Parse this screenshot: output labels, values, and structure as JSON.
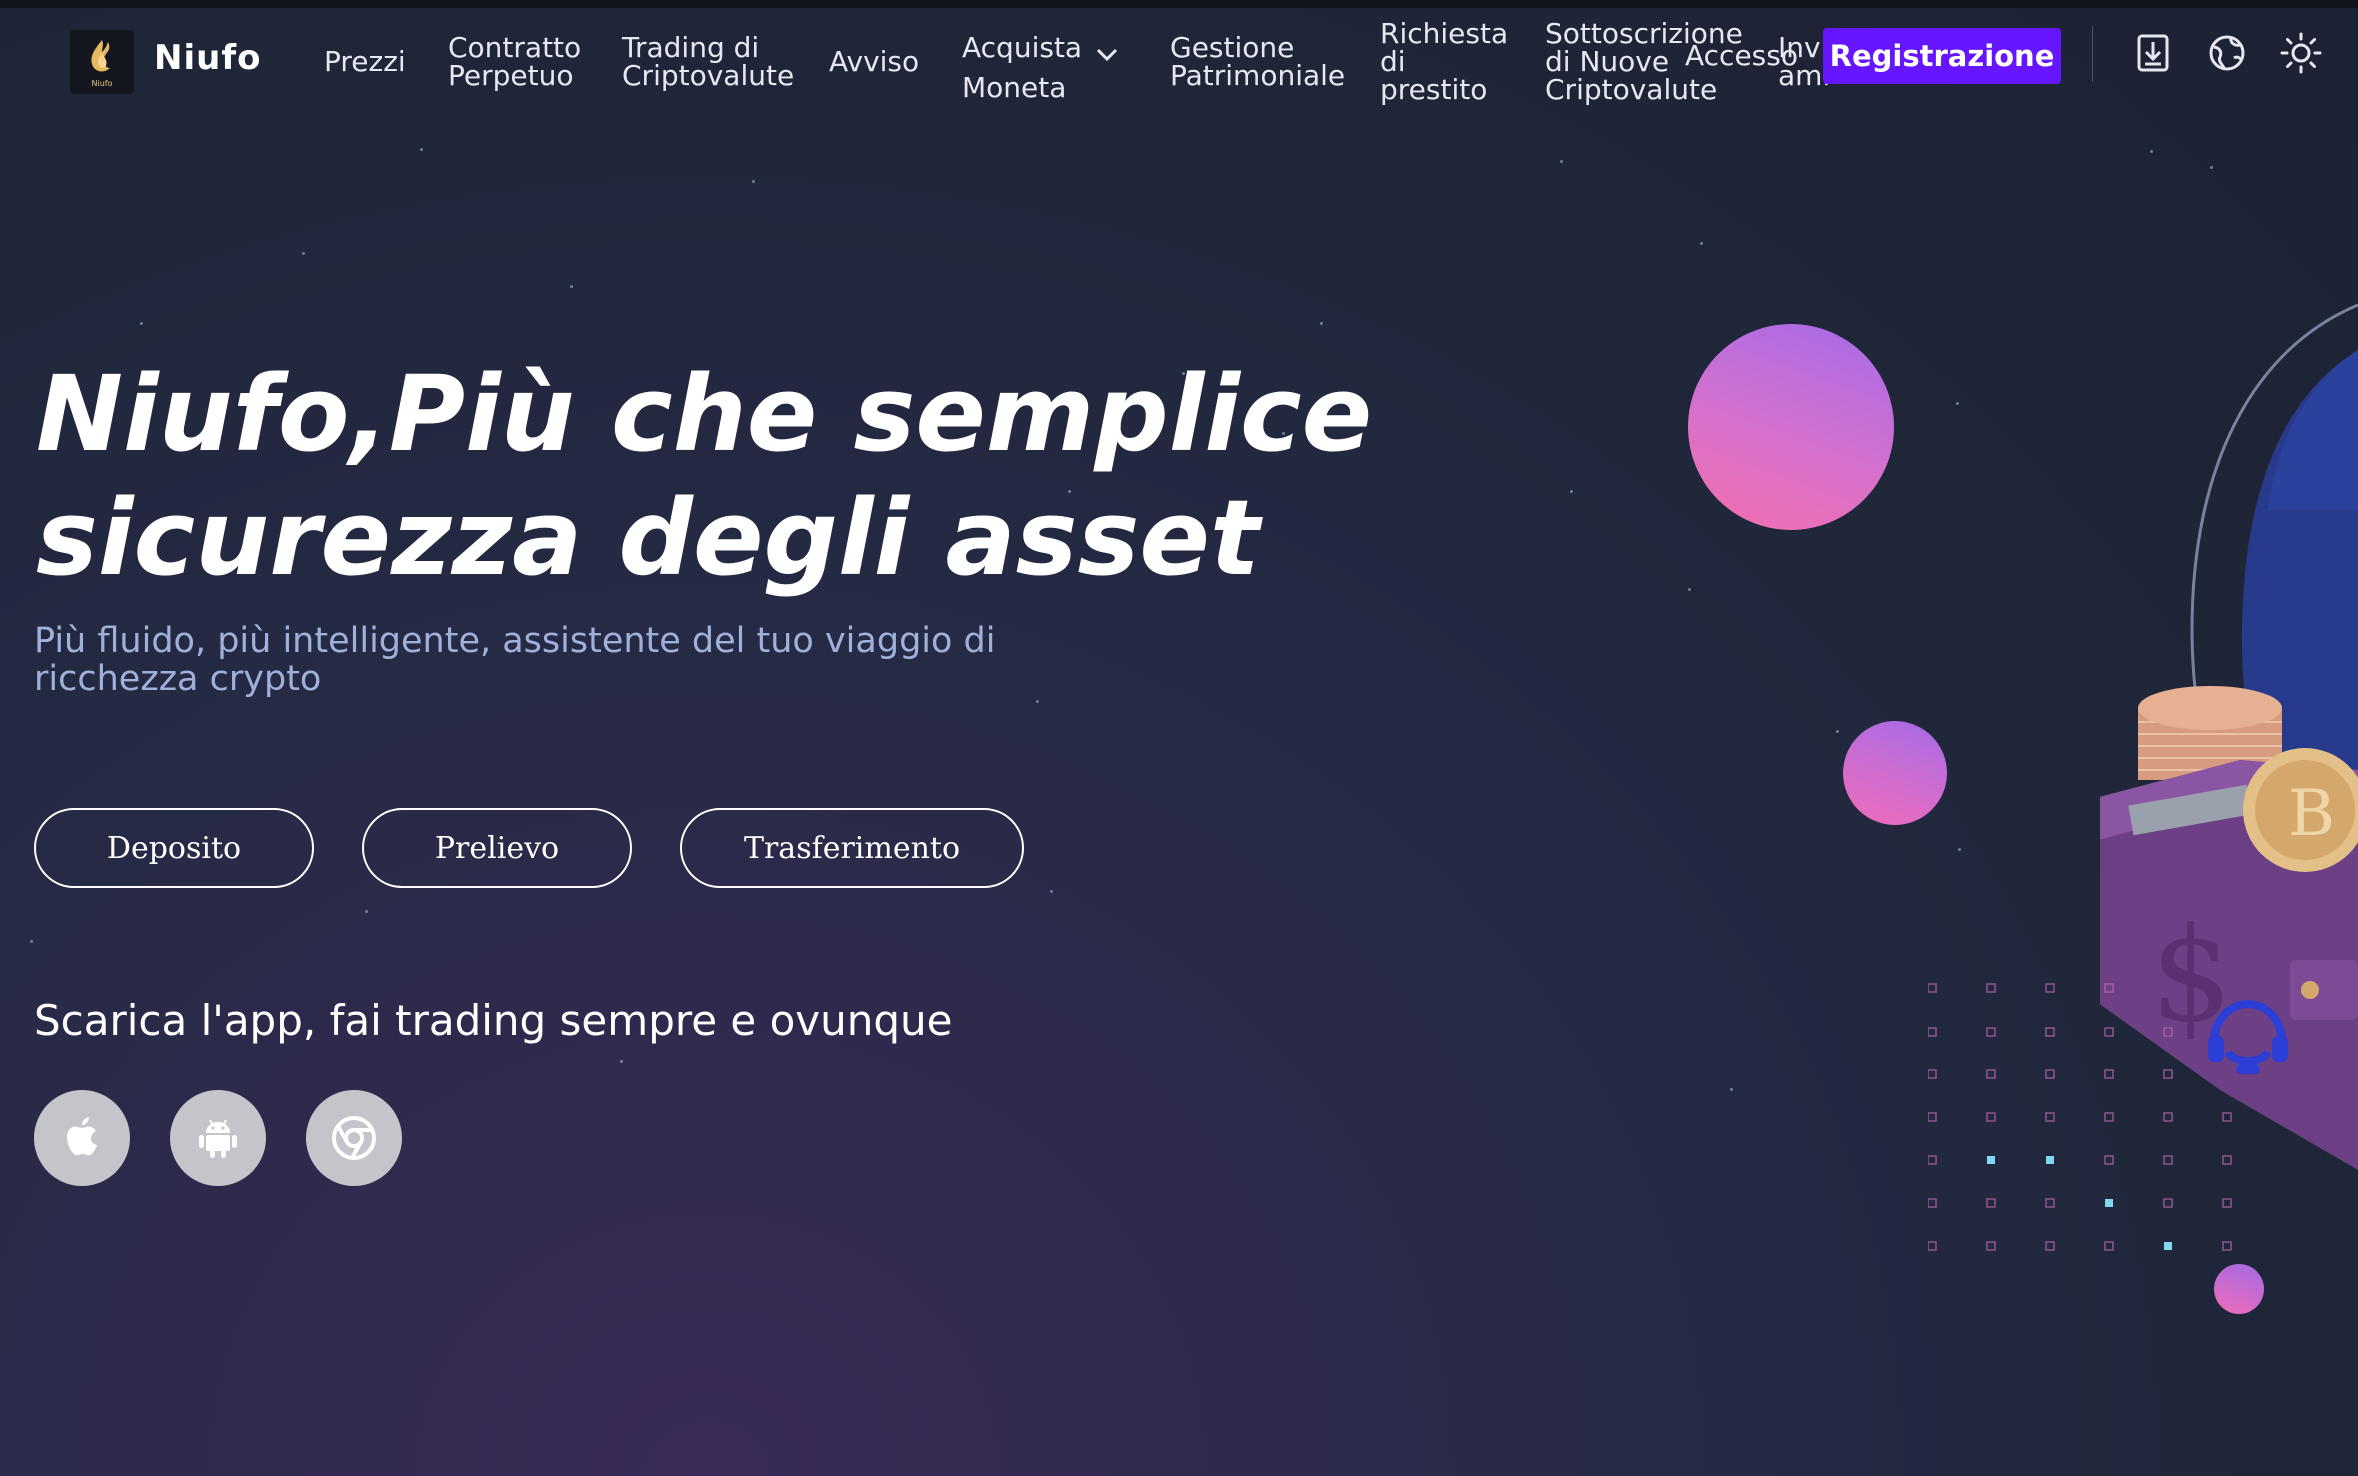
{
  "brand": {
    "name": "Niufo",
    "logo_text": "Niufo",
    "logo_icon": "flame-logo-icon"
  },
  "nav": {
    "prezzi": [
      "Prezzi"
    ],
    "contratto": [
      "Contratto",
      "Perpetuo"
    ],
    "trading": [
      "Trading di",
      "Criptovalute"
    ],
    "avviso": [
      "Avviso"
    ],
    "acquista": [
      "Acquista",
      "Moneta"
    ],
    "gestione": [
      "Gestione",
      "Patrimoniale"
    ],
    "richiesta": [
      "Richiesta",
      "di",
      "prestito"
    ],
    "sottoscrizione": [
      "Sottoscrizione",
      "di Nuove",
      "Criptovalute"
    ],
    "accesso": "Accesso",
    "invita": [
      "Invi",
      "ami"
    ]
  },
  "header": {
    "register_label": "Registrazione",
    "icons": [
      "download-icon",
      "globe-icon",
      "sun-icon"
    ],
    "accent": "#6516ff"
  },
  "hero": {
    "title_line1": "Niufo,Più che semplice",
    "title_line2": "sicurezza degli asset",
    "subtitle": "Più fluido, più intelligente, assistente del tuo viaggio di ricchezza crypto",
    "buttons": {
      "deposit": "Deposito",
      "withdraw": "Prelievo",
      "transfer": "Trasferimento"
    },
    "download_title": "Scarica l'app, fai trading sempre e ovunque",
    "apps": [
      "apple-icon",
      "android-icon",
      "chrome-icon"
    ]
  },
  "support": {
    "icon": "headset-support-icon"
  }
}
